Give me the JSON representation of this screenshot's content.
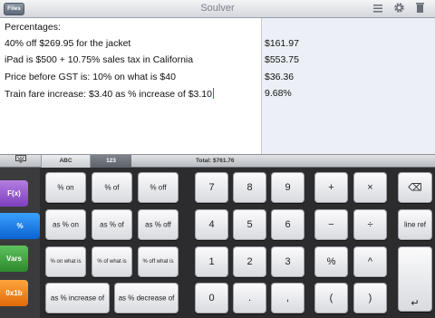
{
  "app": {
    "title": "Soulver"
  },
  "toolbar": {
    "files_label": "Files",
    "list_icon": "list-icon",
    "settings_icon": "gear-icon",
    "trash_icon": "trash-icon"
  },
  "editor": {
    "lines": [
      "Percentages:",
      "40% off $269.95 for the jacket",
      "iPad is $500 + 10.75% sales tax in California",
      "Price before GST is: 10% on what is $40",
      "Train fare increase: $3.40 as % increase of $3.10"
    ],
    "answers": [
      "",
      "$161.97",
      "$553.75",
      "$36.36",
      "9.68%"
    ]
  },
  "keyboard_bar": {
    "hide_icon": "keyboard-icon",
    "tabs": [
      "ABC",
      "123"
    ],
    "selected_tab": "123",
    "total": "Total: $761.76"
  },
  "function_keys": [
    "F(x)",
    "%",
    "Vars",
    "0x1b"
  ],
  "percent_keys": [
    [
      "% on",
      "% of",
      "% off"
    ],
    [
      "as % on",
      "as % of",
      "as % off"
    ],
    [
      "% on what is",
      "% of what is",
      "% off what is"
    ],
    [
      "as % increase of",
      "as % decrease of"
    ]
  ],
  "number_keys": [
    [
      "7",
      "8",
      "9"
    ],
    [
      "4",
      "5",
      "6"
    ],
    [
      "1",
      "2",
      "3"
    ],
    [
      "0",
      ".",
      ","
    ]
  ],
  "operator_keys": [
    [
      "+",
      "×",
      "⌫"
    ],
    [
      "−",
      "÷",
      "line ref"
    ],
    [
      "%",
      "^"
    ],
    [
      "(",
      ")",
      "↵"
    ]
  ],
  "colors": {
    "purple": "#8f4fd0",
    "blue": "#1476e6",
    "green": "#3a9c3a",
    "orange": "#f28a1e",
    "caret": "#2a6cd6"
  }
}
